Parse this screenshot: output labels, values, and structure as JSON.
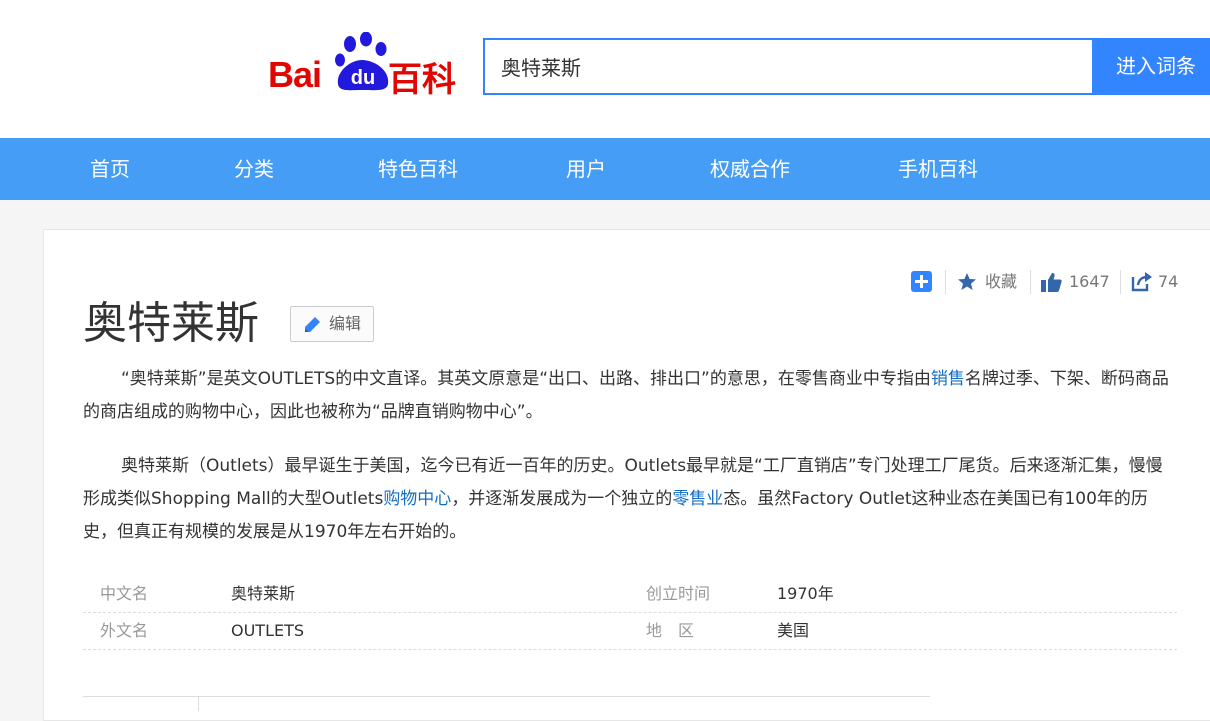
{
  "logo": {
    "bai": "Bai",
    "du": "du",
    "baike": "百科"
  },
  "search": {
    "value": "奥特莱斯",
    "button": "进入词条"
  },
  "nav": [
    "首页",
    "分类",
    "特色百科",
    "用户",
    "权威合作",
    "手机百科"
  ],
  "toolbar": {
    "collect": "收藏",
    "likes": "1647",
    "shares": "74"
  },
  "entry": {
    "title": "奥特莱斯",
    "edit": "编辑",
    "para1": {
      "a": "“奥特莱斯”是英文OUTLETS的中文直译。其英文原意是“出口、出路、排出口”的意思，在零售商业中专指由",
      "link": "销售",
      "b": "名牌过季、下架、断码商品的商店组成的购物中心，因此也被称为“品牌直销购物中心”。"
    },
    "para2": {
      "a": "奥特莱斯（Outlets）最早诞生于美国，迄今已有近一百年的历史。Outlets最早就是“工厂直销店”专门处理工厂尾货。后来逐渐汇集，慢慢形成类似Shopping Mall的大型Outlets",
      "link1": "购物中心",
      "b": "，并逐渐发展成为一个独立的",
      "link2": "零售业",
      "c": "态。虽然Factory Outlet这种业态在美国已有100年的历史，但真正有规模的发展是从1970年左右开始的。"
    }
  },
  "info": [
    {
      "k1": "中文名",
      "v1": "奥特莱斯",
      "k2": "创立时间",
      "v2": "1970年"
    },
    {
      "k1": "外文名",
      "v1": "OUTLETS",
      "k2": "地　区",
      "v2": "美国"
    }
  ],
  "colors": {
    "brand_red": "#e10602",
    "brand_blue": "#2319dc",
    "accent_blue": "#3385ff",
    "nav_blue": "#459df5",
    "link": "#136ec2"
  }
}
